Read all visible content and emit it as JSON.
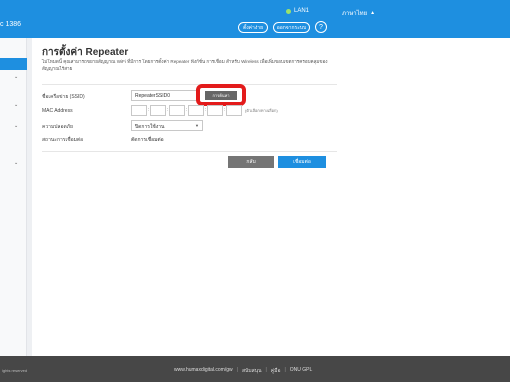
{
  "header": {
    "brand_text": "c 1386",
    "lan_status": "LAN1",
    "language": "ภาษาไทย",
    "button_1": "ตั้งค่าง่าย",
    "button_2": "ออกจากระบบ",
    "help": "?"
  },
  "sidebar": {
    "chevron": "⌄"
  },
  "page": {
    "title": "การตั้งค่า Repeater",
    "description": "ไม่โหมดนี้ คุณสามารถขยายสัญญาณ WiFi ที่มีการ โดยการตั้งค่า Repeater ฟังก์ชั่น การเชื่อม สำหรับ Wireless เพื่อเพิ่มขอบเขตการครอบคลุมของสัญญาณไร้สาย",
    "form": {
      "ssid_label": "ชื่อเครือข่าย (SSID)",
      "ssid_value": "RepeaterSSID0",
      "scan_button": "การค้นหา",
      "mac_label": "MAC Address",
      "mac_hint": "(ตัวเลือก/ทางเลือก)",
      "security_label": "ความปลอดภัย",
      "security_value": "ปิดการใช้งาน",
      "status_label": "สถานะการเชื่อมต่อ",
      "status_value": "ตัดการเชื่อมต่อ"
    },
    "buttons": {
      "back": "กลับ",
      "connect": "เชื่อมต่อ"
    }
  },
  "footer": {
    "copyright": "ights reserved",
    "website": "www.humaxdigital.com/gw",
    "support": "สนับสนุน",
    "manual": "คู่มือ",
    "license": "ONU GPL"
  },
  "colors": {
    "brand_blue": "#1e8fe0",
    "highlight_red": "#e31b1b",
    "footer_bg": "#474747"
  }
}
